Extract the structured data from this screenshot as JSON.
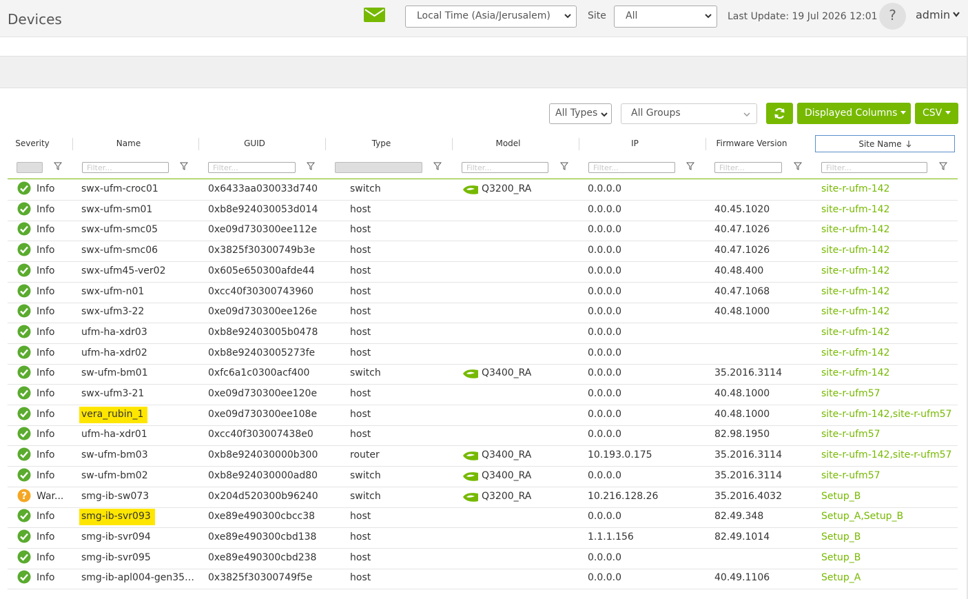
{
  "header": {
    "title": "Devices",
    "timezone_value": "Local Time (Asia/Jerusalem)",
    "site_label": "Site",
    "site_value": "All",
    "last_update": "Last Update: 19 Jul 2026 12:01",
    "help_label": "?",
    "user": "admin",
    "mail_icon": "mail-icon",
    "accent_color": "#76b900"
  },
  "toolbar": {
    "types_value": "All Types",
    "groups_value": "All Groups",
    "refresh_icon": "refresh-icon",
    "columns_label": "Displayed Columns",
    "csv_label": "CSV"
  },
  "table": {
    "columns": [
      "Severity",
      "Name",
      "GUID",
      "Type",
      "Model",
      "IP",
      "Firmware Version",
      "Site Name"
    ],
    "sorted_column": "Site Name",
    "sort_direction": "descending",
    "filter_placeholder": "Filter...",
    "rows": [
      {
        "severity": "Info",
        "sev_icon": "ok",
        "name": "swx-ufm-croc01",
        "guid": "0x6433aa030033d740",
        "type": "switch",
        "model": "Q3200_RA",
        "ip": "0.0.0.0",
        "firmware": "",
        "site": "site-r-ufm-142"
      },
      {
        "severity": "Info",
        "sev_icon": "ok",
        "name": "swx-ufm-sm01",
        "guid": "0xb8e924030053d014",
        "type": "host",
        "model": "",
        "ip": "0.0.0.0",
        "firmware": "40.45.1020",
        "site": "site-r-ufm-142"
      },
      {
        "severity": "Info",
        "sev_icon": "ok",
        "name": "swx-ufm-smc05",
        "guid": "0xe09d730300ee112e",
        "type": "host",
        "model": "",
        "ip": "0.0.0.0",
        "firmware": "40.47.1026",
        "site": "site-r-ufm-142"
      },
      {
        "severity": "Info",
        "sev_icon": "ok",
        "name": "swx-ufm-smc06",
        "guid": "0x3825f30300749b3e",
        "type": "host",
        "model": "",
        "ip": "0.0.0.0",
        "firmware": "40.47.1026",
        "site": "site-r-ufm-142"
      },
      {
        "severity": "Info",
        "sev_icon": "ok",
        "name": "swx-ufm45-ver02",
        "guid": "0x605e650300afde44",
        "type": "host",
        "model": "",
        "ip": "0.0.0.0",
        "firmware": "40.48.400",
        "site": "site-r-ufm-142"
      },
      {
        "severity": "Info",
        "sev_icon": "ok",
        "name": "swx-ufm-n01",
        "guid": "0xcc40f30300743960",
        "type": "host",
        "model": "",
        "ip": "0.0.0.0",
        "firmware": "40.47.1068",
        "site": "site-r-ufm-142"
      },
      {
        "severity": "Info",
        "sev_icon": "ok",
        "name": "swx-ufm3-22",
        "guid": "0xe09d730300ee126e",
        "type": "host",
        "model": "",
        "ip": "0.0.0.0",
        "firmware": "40.48.1000",
        "site": "site-r-ufm-142"
      },
      {
        "severity": "Info",
        "sev_icon": "ok",
        "name": "ufm-ha-xdr03",
        "guid": "0xb8e92403005b0478",
        "type": "host",
        "model": "",
        "ip": "0.0.0.0",
        "firmware": "",
        "site": "site-r-ufm-142"
      },
      {
        "severity": "Info",
        "sev_icon": "ok",
        "name": "ufm-ha-xdr02",
        "guid": "0xb8e92403005273fe",
        "type": "host",
        "model": "",
        "ip": "0.0.0.0",
        "firmware": "",
        "site": "site-r-ufm-142"
      },
      {
        "severity": "Info",
        "sev_icon": "ok",
        "name": "sw-ufm-bm01",
        "guid": "0xfc6a1c0300acf400",
        "type": "switch",
        "model": "Q3400_RA",
        "ip": "0.0.0.0",
        "firmware": "35.2016.3114",
        "site": "site-r-ufm-142"
      },
      {
        "severity": "Info",
        "sev_icon": "ok",
        "name": "swx-ufm3-21",
        "guid": "0xe09d730300ee120e",
        "type": "host",
        "model": "",
        "ip": "0.0.0.0",
        "firmware": "40.48.1000",
        "site": "site-r-ufm57"
      },
      {
        "severity": "Info",
        "sev_icon": "ok",
        "name": "vera_rubin_1",
        "highlight": true,
        "guid": "0xe09d730300ee108e",
        "type": "host",
        "model": "",
        "ip": "0.0.0.0",
        "firmware": "40.48.1000",
        "site": "site-r-ufm-142,site-r-ufm57"
      },
      {
        "severity": "Info",
        "sev_icon": "ok",
        "name": "ufm-ha-xdr01",
        "guid": "0xcc40f303007438e0",
        "type": "host",
        "model": "",
        "ip": "0.0.0.0",
        "firmware": "82.98.1950",
        "site": "site-r-ufm57"
      },
      {
        "severity": "Info",
        "sev_icon": "ok",
        "name": "sw-ufm-bm03",
        "guid": "0xb8e924030000b300",
        "type": "router",
        "model": "Q3400_RA",
        "ip": "10.193.0.175",
        "firmware": "35.2016.3114",
        "site": "site-r-ufm-142,site-r-ufm57"
      },
      {
        "severity": "Info",
        "sev_icon": "ok",
        "name": "sw-ufm-bm02",
        "guid": "0xb8e924030000ad80",
        "type": "switch",
        "model": "Q3400_RA",
        "ip": "0.0.0.0",
        "firmware": "35.2016.3114",
        "site": "site-r-ufm57"
      },
      {
        "severity": "War...",
        "sev_icon": "warning",
        "name": "smg-ib-sw073",
        "guid": "0x204d520300b96240",
        "type": "switch",
        "model": "Q3200_RA",
        "ip": "10.216.128.26",
        "firmware": "35.2016.4032",
        "site": "Setup_B"
      },
      {
        "severity": "Info",
        "sev_icon": "ok",
        "name": "smg-ib-svr093",
        "highlight": true,
        "guid": "0xe89e490300cbcc38",
        "type": "host",
        "model": "",
        "ip": "0.0.0.0",
        "firmware": "82.49.348",
        "site": "Setup_A,Setup_B"
      },
      {
        "severity": "Info",
        "sev_icon": "ok",
        "name": "smg-ib-svr094",
        "guid": "0xe89e490300cbd138",
        "type": "host",
        "model": "",
        "ip": "1.1.1.156",
        "firmware": "82.49.1014",
        "site": "Setup_B"
      },
      {
        "severity": "Info",
        "sev_icon": "ok",
        "name": "smg-ib-svr095",
        "guid": "0xe89e490300cbd238",
        "type": "host",
        "model": "",
        "ip": "0.0.0.0",
        "firmware": "",
        "site": "Setup_B"
      },
      {
        "severity": "Info",
        "sev_icon": "ok",
        "name": "smg-ib-apl004-gen35d...",
        "guid": "0x3825f30300749f5e",
        "type": "host",
        "model": "",
        "ip": "0.0.0.0",
        "firmware": "40.49.1106",
        "site": "Setup_A"
      }
    ]
  }
}
